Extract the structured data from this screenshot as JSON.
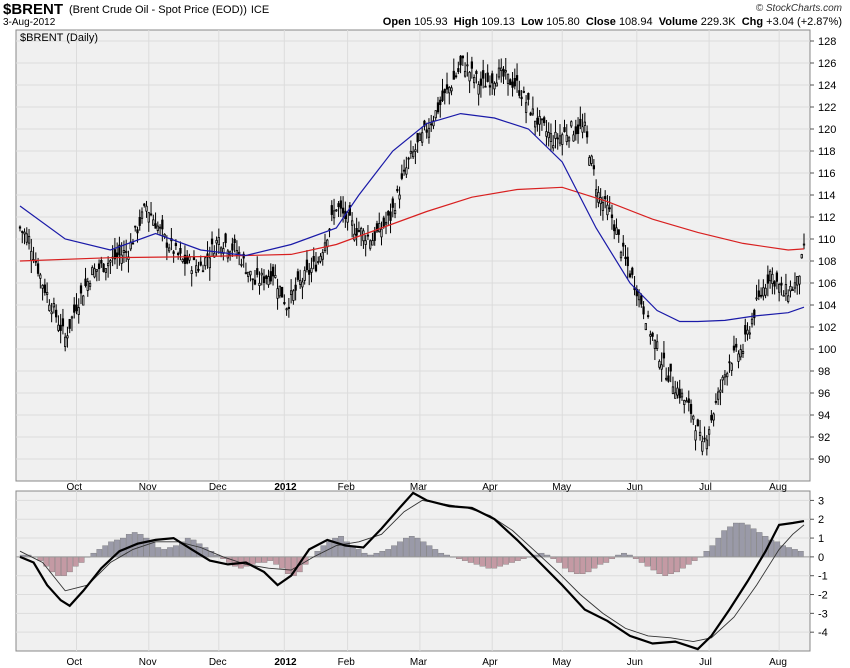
{
  "header": {
    "symbol": "$BRENT",
    "description": "(Brent Crude Oil - Spot Price (EOD))",
    "exchange": "ICE",
    "date": "3-Aug-2012",
    "logo": "© StockCharts.com",
    "open_label": "Open",
    "open": "105.93",
    "high_label": "High",
    "high": "109.13",
    "low_label": "Low",
    "low": "105.80",
    "close_label": "Close",
    "close": "108.94",
    "volume_label": "Volume",
    "volume": "229.3K",
    "chg_label": "Chg",
    "chg": "+3.04 (+2.87%)"
  },
  "colors": {
    "bg": "#f0f0f0",
    "grid": "#dcdcdc",
    "ma_short": "#1a1aa8",
    "ma_long": "#d82020",
    "hist_pos": "#9a9aa8",
    "hist_neg": "#c49aa4",
    "candle": "#000000"
  },
  "chart_data": [
    {
      "type": "candlestick",
      "panel_label": "$BRENT (Daily)",
      "x_labels": [
        "Oct",
        "Nov",
        "Dec",
        "2012",
        "Feb",
        "Mar",
        "Apr",
        "May",
        "Jun",
        "Jul",
        "Aug"
      ],
      "bold_x_labels": [
        "2012"
      ],
      "ylim": [
        88,
        129
      ],
      "y_ticks": [
        90,
        92,
        94,
        96,
        98,
        100,
        102,
        104,
        106,
        108,
        110,
        112,
        114,
        116,
        118,
        120,
        122,
        124,
        126,
        128
      ],
      "grid": true,
      "price_path": [
        [
          0,
          111
        ],
        [
          4,
          110
        ],
        [
          10,
          106
        ],
        [
          16,
          103
        ],
        [
          20,
          101
        ],
        [
          25,
          104
        ],
        [
          32,
          107
        ],
        [
          40,
          108
        ],
        [
          48,
          109
        ],
        [
          56,
          113
        ],
        [
          64,
          110
        ],
        [
          72,
          108
        ],
        [
          80,
          107.5
        ],
        [
          88,
          110
        ],
        [
          96,
          109
        ],
        [
          104,
          106
        ],
        [
          112,
          107
        ],
        [
          118,
          104
        ],
        [
          124,
          106
        ],
        [
          132,
          108
        ],
        [
          140,
          113
        ],
        [
          148,
          111
        ],
        [
          156,
          110
        ],
        [
          164,
          112
        ],
        [
          172,
          117
        ],
        [
          180,
          120
        ],
        [
          188,
          123
        ],
        [
          196,
          126
        ],
        [
          204,
          124
        ],
        [
          212,
          125
        ],
        [
          220,
          124
        ],
        [
          228,
          121
        ],
        [
          236,
          119
        ],
        [
          244,
          120
        ],
        [
          250,
          120
        ],
        [
          256,
          114
        ],
        [
          262,
          112
        ],
        [
          268,
          108
        ],
        [
          274,
          105
        ],
        [
          280,
          101
        ],
        [
          286,
          98
        ],
        [
          292,
          96
        ],
        [
          298,
          94
        ],
        [
          302,
          91
        ],
        [
          308,
          95
        ],
        [
          314,
          99
        ],
        [
          320,
          100
        ],
        [
          326,
          104
        ],
        [
          332,
          107
        ],
        [
          338,
          105
        ],
        [
          344,
          106
        ],
        [
          347,
          108.9
        ]
      ],
      "ma_short": [
        [
          0,
          113
        ],
        [
          20,
          110
        ],
        [
          40,
          109
        ],
        [
          60,
          110.5
        ],
        [
          80,
          109
        ],
        [
          100,
          108.5
        ],
        [
          120,
          109.5
        ],
        [
          140,
          111
        ],
        [
          150,
          114
        ],
        [
          165,
          118
        ],
        [
          180,
          120.5
        ],
        [
          195,
          121.4
        ],
        [
          210,
          121
        ],
        [
          225,
          120
        ],
        [
          240,
          117
        ],
        [
          255,
          111
        ],
        [
          270,
          106
        ],
        [
          282,
          103.5
        ],
        [
          292,
          102.5
        ],
        [
          300,
          102.5
        ],
        [
          312,
          102.6
        ],
        [
          325,
          103
        ],
        [
          340,
          103.3
        ],
        [
          347,
          103.8
        ]
      ],
      "ma_long": [
        [
          0,
          108
        ],
        [
          40,
          108.3
        ],
        [
          80,
          108.4
        ],
        [
          120,
          108.6
        ],
        [
          140,
          109.5
        ],
        [
          160,
          111
        ],
        [
          180,
          112.5
        ],
        [
          200,
          113.8
        ],
        [
          220,
          114.5
        ],
        [
          240,
          114.7
        ],
        [
          260,
          113.4
        ],
        [
          280,
          111.8
        ],
        [
          300,
          110.6
        ],
        [
          320,
          109.6
        ],
        [
          340,
          109
        ],
        [
          347,
          109.1
        ]
      ],
      "ma_short_label": "",
      "ma_long_label": ""
    },
    {
      "type": "line",
      "panel_label": "",
      "ylim": [
        -5,
        3.5
      ],
      "y_ticks": [
        -4,
        -3,
        -2,
        -1,
        0,
        1,
        2,
        3
      ],
      "x_labels": [
        "Oct",
        "Nov",
        "Dec",
        "2012",
        "Feb",
        "Mar",
        "Apr",
        "May",
        "Jun",
        "Jul",
        "Aug"
      ],
      "series": [
        {
          "values": [
            [
              0,
              0
            ],
            [
              6,
              -0.3
            ],
            [
              12,
              -1.5
            ],
            [
              18,
              -2.3
            ],
            [
              22,
              -2.6
            ],
            [
              28,
              -1.8
            ],
            [
              36,
              -0.6
            ],
            [
              44,
              0.3
            ],
            [
              52,
              0.7
            ],
            [
              60,
              0.9
            ],
            [
              68,
              1
            ],
            [
              76,
              0.4
            ],
            [
              84,
              -0.2
            ],
            [
              92,
              -0.4
            ],
            [
              100,
              -0.3
            ],
            [
              108,
              -0.8
            ],
            [
              114,
              -1.5
            ],
            [
              120,
              -1
            ],
            [
              128,
              0.4
            ],
            [
              136,
              0.9
            ],
            [
              144,
              0.6
            ],
            [
              152,
              0.5
            ],
            [
              160,
              1.5
            ],
            [
              168,
              2.6
            ],
            [
              174,
              3.4
            ],
            [
              180,
              3
            ],
            [
              190,
              2.7
            ],
            [
              200,
              2.6
            ],
            [
              210,
              2
            ],
            [
              220,
              0.9
            ],
            [
              230,
              -0.3
            ],
            [
              240,
              -1.5
            ],
            [
              250,
              -2.8
            ],
            [
              260,
              -3.4
            ],
            [
              270,
              -4.2
            ],
            [
              280,
              -4.6
            ],
            [
              290,
              -4.5
            ],
            [
              300,
              -4.9
            ],
            [
              306,
              -4.2
            ],
            [
              314,
              -2.8
            ],
            [
              322,
              -1.3
            ],
            [
              330,
              0.3
            ],
            [
              336,
              1.7
            ],
            [
              342,
              1.8
            ],
            [
              347,
              1.9
            ]
          ]
        },
        {
          "values": [
            [
              0,
              0.3
            ],
            [
              10,
              -0.3
            ],
            [
              20,
              -1.8
            ],
            [
              30,
              -1.5
            ],
            [
              40,
              -0.3
            ],
            [
              50,
              0.4
            ],
            [
              60,
              0.8
            ],
            [
              70,
              0.8
            ],
            [
              80,
              0.5
            ],
            [
              90,
              0
            ],
            [
              100,
              -0.4
            ],
            [
              110,
              -0.6
            ],
            [
              120,
              -0.7
            ],
            [
              130,
              0
            ],
            [
              140,
              0.6
            ],
            [
              150,
              0.8
            ],
            [
              160,
              1.2
            ],
            [
              170,
              2.4
            ],
            [
              178,
              3
            ],
            [
              188,
              2.8
            ],
            [
              198,
              2.6
            ],
            [
              208,
              2.2
            ],
            [
              218,
              1.4
            ],
            [
              228,
              0.3
            ],
            [
              238,
              -0.8
            ],
            [
              248,
              -2
            ],
            [
              258,
              -3
            ],
            [
              268,
              -3.8
            ],
            [
              278,
              -4.2
            ],
            [
              288,
              -4.3
            ],
            [
              298,
              -4.5
            ],
            [
              306,
              -4.3
            ],
            [
              316,
              -3.2
            ],
            [
              326,
              -1.5
            ],
            [
              336,
              0.4
            ],
            [
              342,
              1.2
            ],
            [
              347,
              1.7
            ]
          ]
        }
      ],
      "histogram": [
        0.1,
        0.1,
        0,
        -0.2,
        -0.5,
        -0.8,
        -1,
        -1,
        -0.8,
        -0.5,
        -0.3,
        0,
        0.2,
        0.4,
        0.6,
        0.8,
        0.9,
        1,
        1.2,
        1.3,
        1.2,
        1,
        0.8,
        0.5,
        0.4,
        0.5,
        0.6,
        0.8,
        1,
        0.9,
        0.7,
        0.5,
        0.3,
        0.1,
        -0.1,
        -0.3,
        -0.5,
        -0.6,
        -0.5,
        -0.4,
        -0.3,
        -0.3,
        -0.2,
        -0.4,
        -0.6,
        -0.9,
        -1,
        -0.8,
        -0.4,
        0,
        0.3,
        0.6,
        0.8,
        1,
        1.1,
        0.8,
        0.6,
        0.4,
        0.2,
        0.1,
        0.2,
        0.3,
        0.4,
        0.6,
        0.8,
        1,
        1.1,
        1,
        0.8,
        0.6,
        0.4,
        0.2,
        0.1,
        0,
        -0.1,
        -0.2,
        -0.3,
        -0.4,
        -0.5,
        -0.6,
        -0.6,
        -0.5,
        -0.4,
        -0.3,
        -0.2,
        -0.1,
        0,
        0.1,
        0.2,
        0.1,
        -0.1,
        -0.3,
        -0.6,
        -0.8,
        -0.9,
        -0.9,
        -0.8,
        -0.6,
        -0.4,
        -0.3,
        -0.1,
        0.1,
        0.2,
        0.1,
        -0.1,
        -0.3,
        -0.5,
        -0.7,
        -0.9,
        -1,
        -0.9,
        -0.8,
        -0.6,
        -0.4,
        -0.2,
        0,
        0.3,
        0.6,
        1,
        1.4,
        1.6,
        1.8,
        1.8,
        1.7,
        1.5,
        1.3,
        1.1,
        0.9,
        0.8,
        0.6,
        0.5,
        0.4,
        0.3
      ]
    }
  ]
}
